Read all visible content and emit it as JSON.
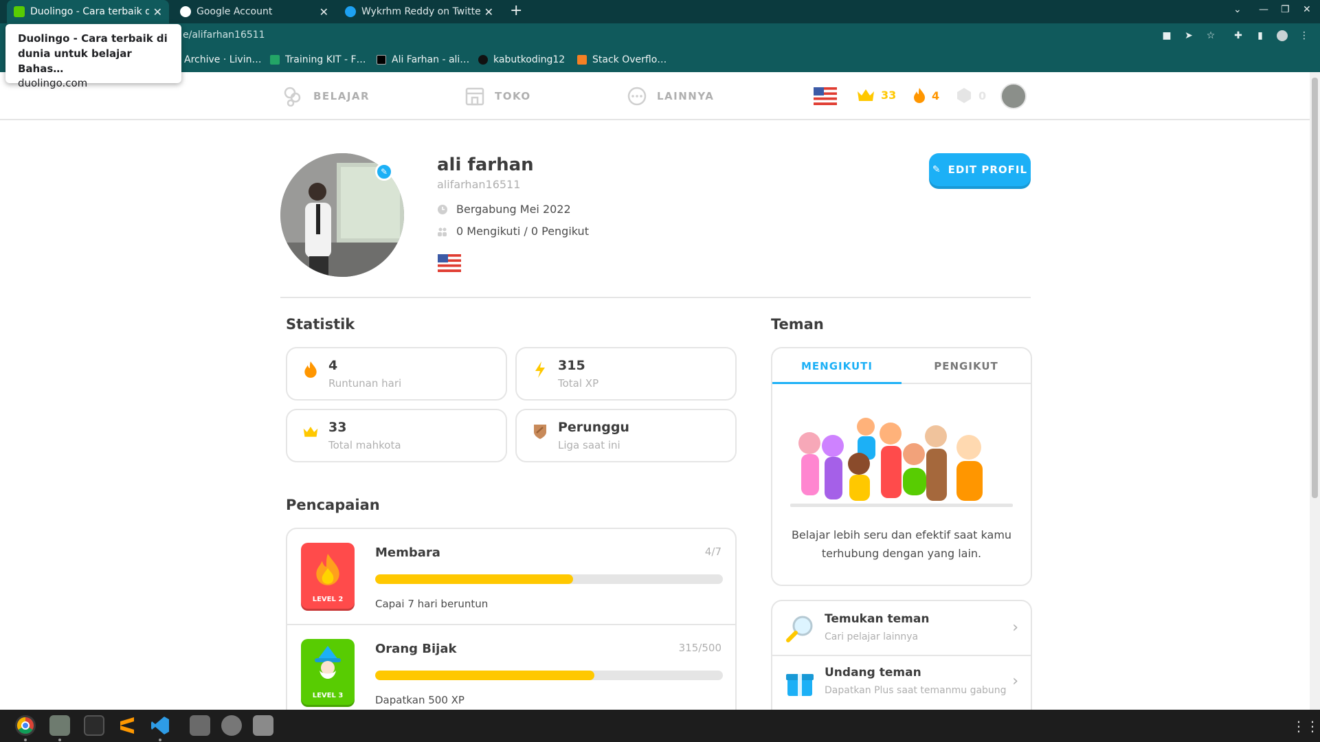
{
  "browser": {
    "tabs": [
      {
        "title": "Duolingo - Cara terbaik di dunia",
        "active": true
      },
      {
        "title": "Google Account",
        "active": false
      },
      {
        "title": "Wykrhm Reddy on Twitter",
        "active": false
      }
    ],
    "new_tab": "+",
    "url": "e/alifarhan16511",
    "bookmarks": [
      "Archive · Livin…",
      "Training KIT - F…",
      "Ali Farhan - ali…",
      "kabutkoding12",
      "Stack Overflo…"
    ],
    "tooltip": {
      "title": "Duolingo - Cara terbaik di dunia untuk belajar Bahas…",
      "site": "duolingo.com"
    }
  },
  "nav": {
    "learn": "BELAJAR",
    "shop": "TOKO",
    "more": "LAINNYA",
    "crowns": "33",
    "streak": "4",
    "gems": "0"
  },
  "profile": {
    "name": "ali farhan",
    "username": "alifarhan16511",
    "joined": "Bergabung Mei 2022",
    "follow": "0 Mengikuti / 0 Pengikut",
    "edit_button": "EDIT PROFIL"
  },
  "stats": {
    "heading": "Statistik",
    "items": [
      {
        "value": "4",
        "label": "Runtunan hari"
      },
      {
        "value": "315",
        "label": "Total XP"
      },
      {
        "value": "33",
        "label": "Total mahkota"
      },
      {
        "value": "Perunggu",
        "label": "Liga saat ini"
      }
    ]
  },
  "achievements": {
    "heading": "Pencapaian",
    "items": [
      {
        "name": "Membara",
        "progress": "4/7",
        "fill": 0.57,
        "desc": "Capai 7 hari beruntun",
        "level": "LEVEL 2"
      },
      {
        "name": "Orang Bijak",
        "progress": "315/500",
        "fill": 0.63,
        "desc": "Dapatkan 500 XP",
        "level": "LEVEL 3"
      }
    ]
  },
  "friends": {
    "heading": "Teman",
    "tab_following": "MENGIKUTI",
    "tab_followers": "PENGIKUT",
    "empty_text": "Belajar lebih seru dan efektif saat kamu terhubung dengan yang lain.",
    "find": {
      "title": "Temukan teman",
      "sub": "Cari pelajar lainnya"
    },
    "invite": {
      "title": "Undang teman",
      "sub": "Dapatkan Plus saat temanmu gabung"
    }
  },
  "colors": {
    "accent": "#1cb0f6",
    "gold": "#ffc800",
    "chrome": "#105a5c"
  }
}
